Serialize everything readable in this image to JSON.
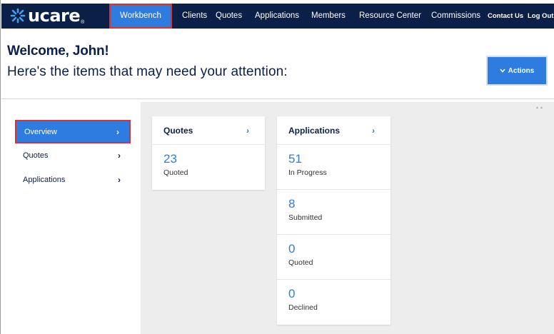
{
  "brand": {
    "name": "ucare",
    "reg": "®",
    "nav_bg": "#0b2048",
    "accent": "#2e7ce0",
    "highlight": "#d93236"
  },
  "nav": {
    "items": [
      {
        "label": "Workbench"
      },
      {
        "label": "Clients"
      },
      {
        "label": "Quotes"
      },
      {
        "label": "Applications"
      },
      {
        "label": "Members"
      },
      {
        "label": "Resource Center"
      },
      {
        "label": "Commissions"
      },
      {
        "label": "Contact Us"
      },
      {
        "label": "Log Out"
      }
    ]
  },
  "header": {
    "welcome": "Welcome, John!",
    "subtitle": "Here's the items that may need your attention:",
    "actions_label": "Actions",
    "actions_icon": "chevron-down-icon"
  },
  "sidebar": {
    "items": [
      {
        "label": "Overview",
        "icon": "chevron-right-icon"
      },
      {
        "label": "Quotes",
        "icon": "chevron-right-icon"
      },
      {
        "label": "Applications",
        "icon": "chevron-right-icon"
      }
    ]
  },
  "cards": {
    "quotes": {
      "title": "Quotes",
      "stats": [
        {
          "value": "23",
          "label": "Quoted"
        }
      ]
    },
    "applications": {
      "title": "Applications",
      "stats": [
        {
          "value": "51",
          "label": "In Progress"
        },
        {
          "value": "8",
          "label": "Submitted"
        },
        {
          "value": "0",
          "label": "Quoted"
        },
        {
          "value": "0",
          "label": "Declined"
        }
      ]
    }
  }
}
